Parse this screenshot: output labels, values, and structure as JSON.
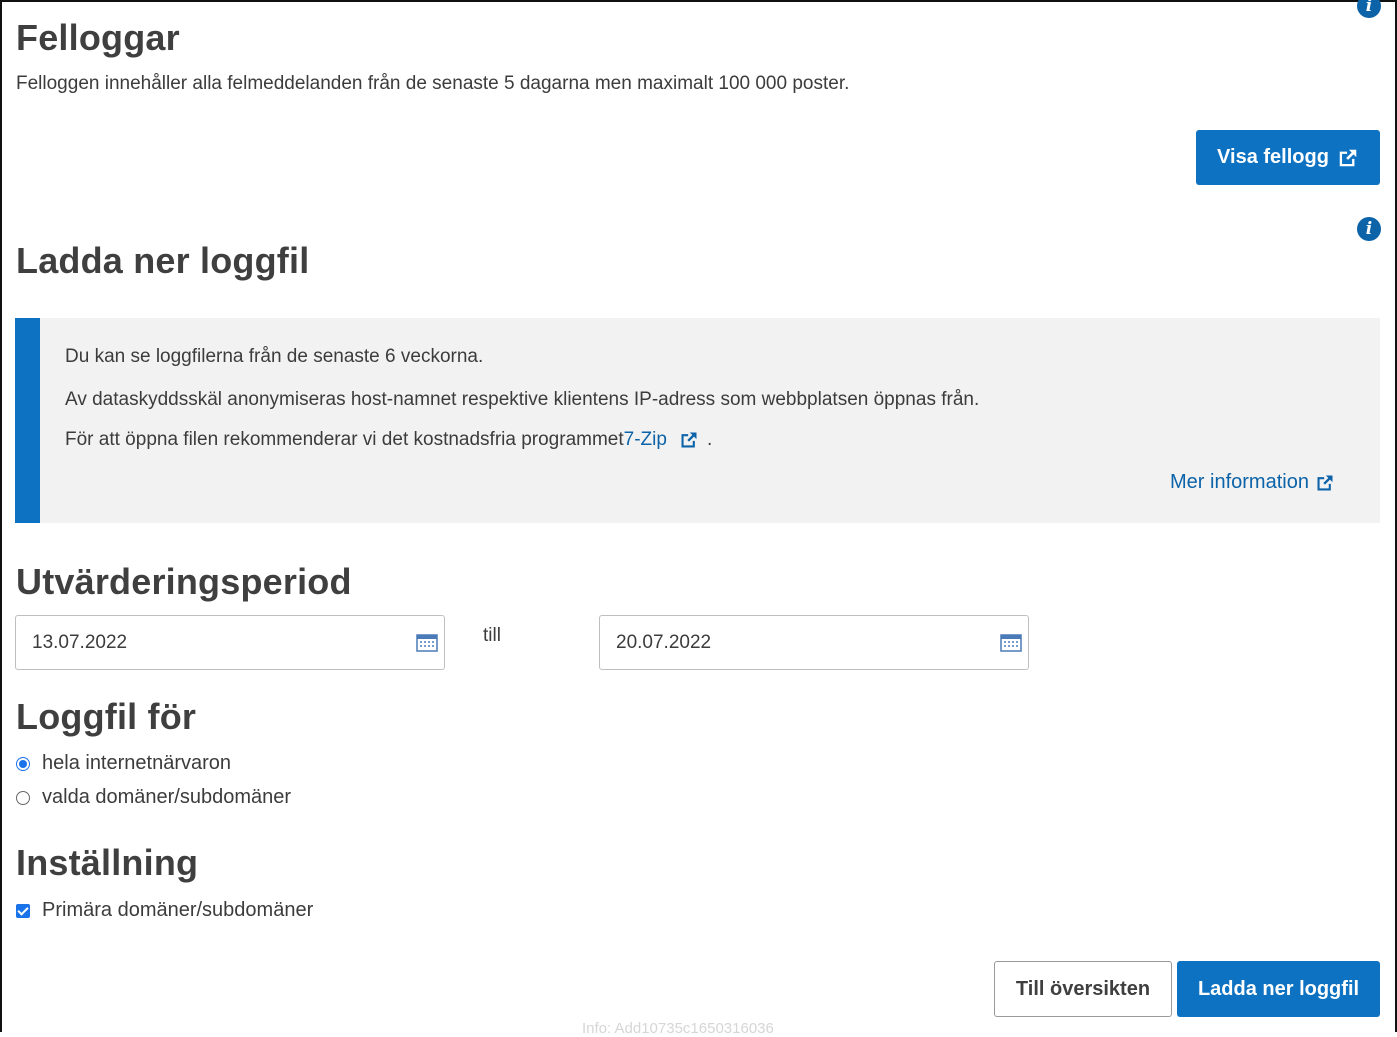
{
  "felloggar": {
    "title": "Felloggar",
    "description": "Felloggen innehåller alla felmeddelanden från de senaste 5 dagarna men maximalt 100 000 poster.",
    "button_label": "Visa fellogg"
  },
  "download": {
    "title": "Ladda ner loggfil",
    "info_lines": [
      "Du kan se loggfilerna från de senaste 6 veckorna.",
      "Av dataskyddsskäl anonymiseras host-namnet respektive klientens IP-adress som webbplatsen öppnas från.",
      "För att öppna filen rekommenderar vi det kostnadsfria programmet"
    ],
    "zip_link": "7-Zip",
    "period_char": ".",
    "more_info_link": "Mer information"
  },
  "period": {
    "title": "Utvärderingsperiod",
    "from": "13.07.2022",
    "separator": "till",
    "to": "20.07.2022"
  },
  "logfile_for": {
    "title": "Loggfil för",
    "options": [
      {
        "label": "hela internetnärvaron",
        "selected": true
      },
      {
        "label": "valda domäner/subdomäner",
        "selected": false
      }
    ]
  },
  "setting": {
    "title": "Inställning",
    "checkbox_label": "Primära domäner/subdomäner",
    "checked": true
  },
  "footer": {
    "back_button": "Till översikten",
    "download_button": "Ladda ner loggfil",
    "faint_text": "Info: Add10735c1650316036"
  },
  "icons": {
    "info": "info-circle-icon",
    "external": "external-link-icon",
    "calendar": "calendar-icon"
  },
  "colors": {
    "primary": "#0d72c2",
    "link": "#0d63a8",
    "infobox_bg": "#f2f2f2"
  }
}
